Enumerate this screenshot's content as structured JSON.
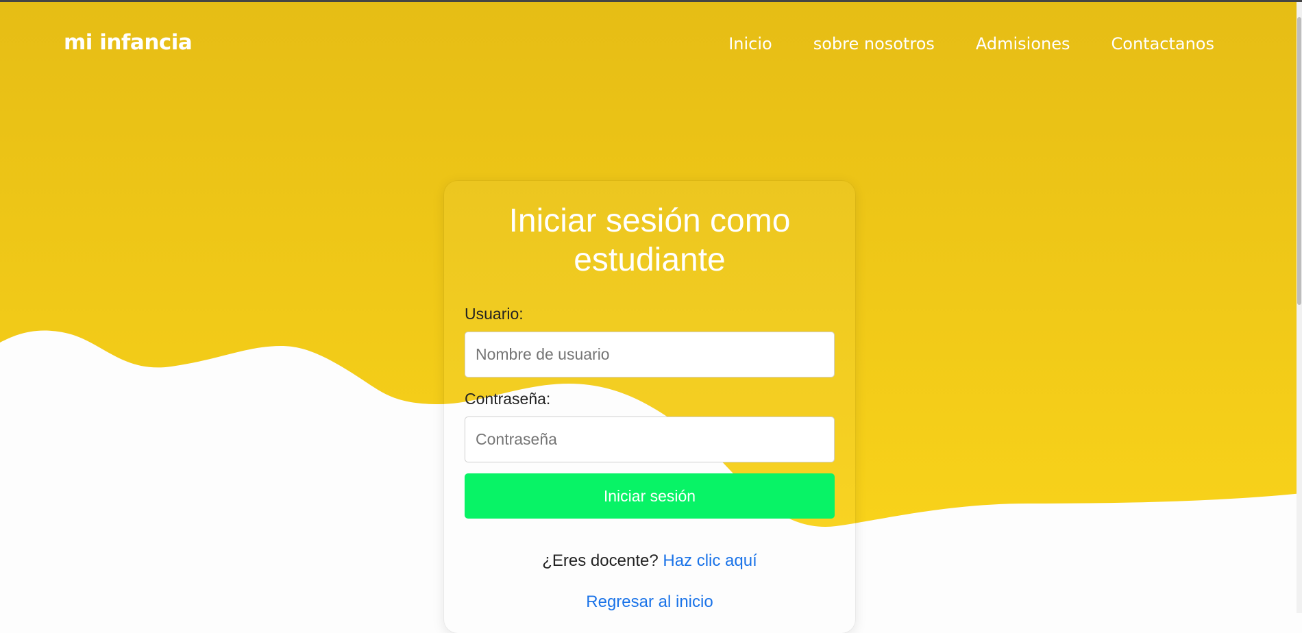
{
  "navbar": {
    "brand": "mi infancia",
    "links": [
      {
        "label": "Inicio"
      },
      {
        "label": "sobre nosotros"
      },
      {
        "label": "Admisiones"
      },
      {
        "label": "Contactanos"
      }
    ]
  },
  "login": {
    "title": "Iniciar sesión como estudiante",
    "username_label": "Usuario:",
    "username_placeholder": "Nombre de usuario",
    "password_label": "Contraseña:",
    "password_placeholder": "Contraseña",
    "submit_label": "Iniciar sesión",
    "teacher_prompt": "¿Eres docente?",
    "teacher_link": "Haz clic aquí",
    "back_link": "Regresar al inicio"
  },
  "colors": {
    "hero_top": "#e6bd15",
    "hero_bottom": "#f8d21a",
    "button": "#08f366",
    "link": "#1a73e8",
    "text": "#222222",
    "background": "#fdfdfd"
  }
}
